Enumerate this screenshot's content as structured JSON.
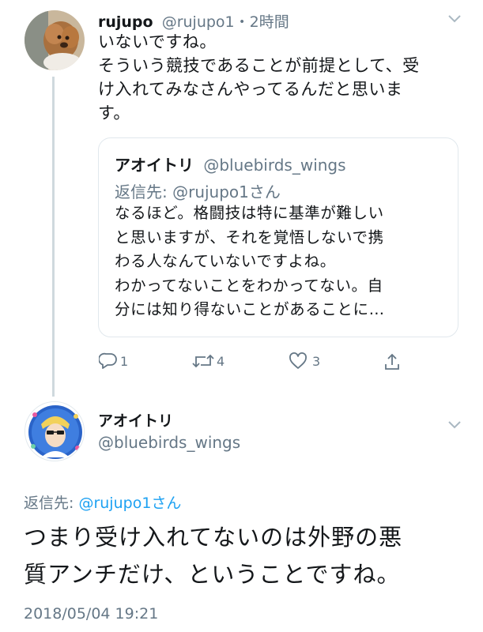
{
  "tweet1": {
    "name": "rujupo",
    "handle": "@rujupo1",
    "time": "・2時間",
    "text": "いないですね。\nそういう競技であることが前提として、受\nけ入れてみなさんやってるんだと思いま\nす。"
  },
  "quote": {
    "name": "アオイトリ",
    "handle": "@bluebirds_wings",
    "reply_label": "返信先: @rujupo1さん",
    "text": "なるほど。格闘技は特に基準が難しい\nと思いますが、それを覚悟しないで携\nわる人なんていないですよね。\nわかってないことをわかってない。自\n分には知り得ないことがあることに…"
  },
  "actions": {
    "reply_count": "1",
    "retweet_count": "4",
    "like_count": "3"
  },
  "tweet2": {
    "name": "アオイトリ",
    "handle": "@bluebirds_wings",
    "reply_prefix": "返信先: ",
    "reply_user": "@rujupo1さん",
    "text": "つまり受け入れてないのは外野の悪\n質アンチだけ、ということですね。",
    "timestamp": "2018/05/04 19:21"
  },
  "icons": {
    "caret": "chevron-down-icon",
    "reply": "reply-icon",
    "retweet": "retweet-icon",
    "like": "heart-icon",
    "share": "share-icon"
  },
  "colors": {
    "link": "#1da1f2",
    "secondary": "#657786",
    "border": "#e1e8ed"
  }
}
